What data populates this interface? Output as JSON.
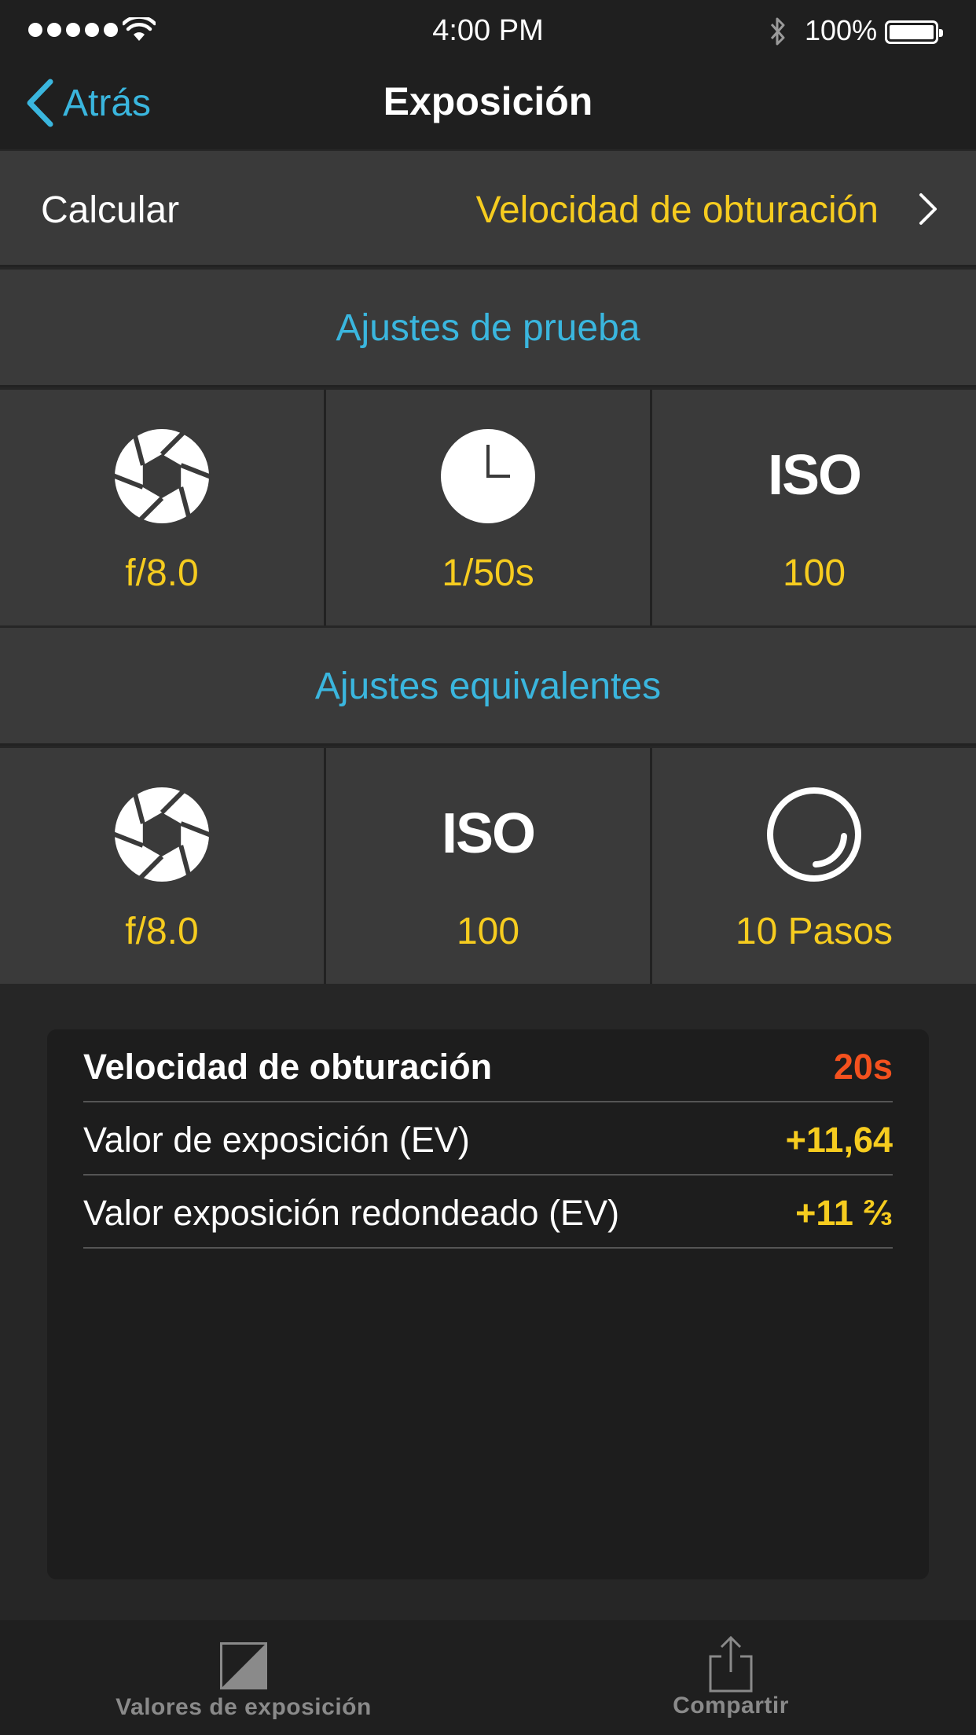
{
  "status_bar": {
    "time": "4:00 PM",
    "battery_percent": "100%",
    "icons": [
      "signal-dots-icon",
      "wifi-icon",
      "bluetooth-icon",
      "battery-icon"
    ]
  },
  "nav": {
    "back_label": "Atrás",
    "title": "Exposición"
  },
  "calculate": {
    "label": "Calcular",
    "value": "Velocidad de obturación"
  },
  "test_settings": {
    "header": "Ajustes de prueba",
    "tiles": [
      {
        "icon": "aperture-icon",
        "value": "f/8.0"
      },
      {
        "icon": "clock-icon",
        "value": "1/50s"
      },
      {
        "icon": "iso-icon",
        "icon_text": "ISO",
        "value": "100"
      }
    ]
  },
  "equivalent_settings": {
    "header": "Ajustes equivalentes",
    "tiles": [
      {
        "icon": "aperture-icon",
        "value": "f/8.0"
      },
      {
        "icon": "iso-icon",
        "icon_text": "ISO",
        "value": "100"
      },
      {
        "icon": "nd-filter-icon",
        "value": "10 Pasos"
      }
    ]
  },
  "results": [
    {
      "label": "Velocidad de obturación",
      "value": "20s",
      "value_color": "#f4511e",
      "bold_label": true
    },
    {
      "label": "Valor de exposición (EV)",
      "value": "+11,64",
      "value_color": "#f6cc1f",
      "bold_label": false
    },
    {
      "label": "Valor exposición redondeado (EV)",
      "value": "+11 ⅔",
      "value_color": "#f6cc1f",
      "bold_label": false
    }
  ],
  "tab_bar": {
    "tabs": [
      {
        "label": "Valores de exposición",
        "icon": "exposure-values-icon"
      },
      {
        "label": "Compartir",
        "icon": "share-icon"
      }
    ]
  },
  "colors": {
    "accent_blue": "#3ab6de",
    "value_yellow": "#f6cc1f",
    "result_orange": "#f4511e"
  }
}
